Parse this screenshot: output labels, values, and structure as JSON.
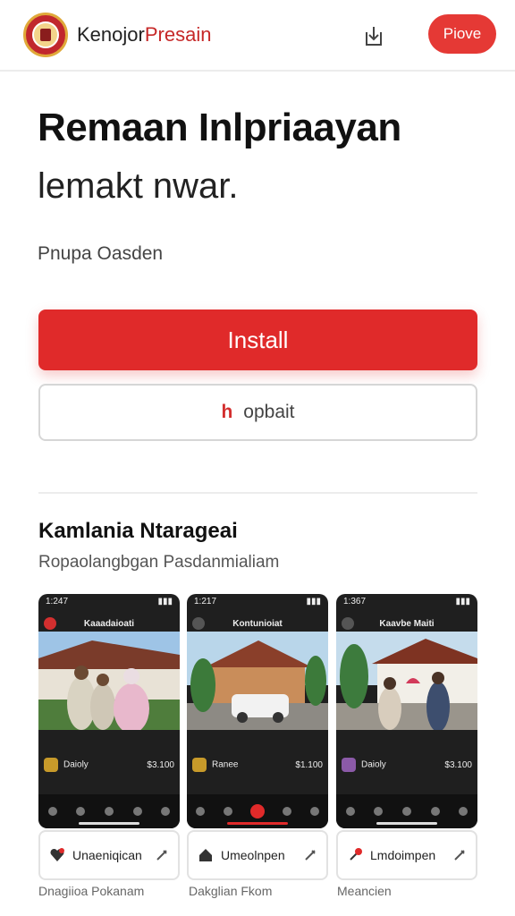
{
  "header": {
    "brand_main": "Kenojor",
    "brand_accent": "Presain",
    "pill_label": "Piove",
    "share_icon": "share-download-icon"
  },
  "hero": {
    "title": "Remaan Inlpriaayan",
    "subtitle": "lemakt nwar.",
    "developer": "Pnupa Oasden"
  },
  "actions": {
    "install_label": "Install",
    "secondary_mark": "h",
    "secondary_label": "opbait"
  },
  "section": {
    "title": "Kamlania Ntarageai",
    "subtitle": "Ropaolangbgan Pasdanmialiam"
  },
  "screenshots": [
    {
      "time": "1:247",
      "header": "Kaaadaioati",
      "price_title": "Daioly",
      "price_value": "$3.100"
    },
    {
      "time": "1:217",
      "header": "Kontunioiat",
      "price_title": "Ranee",
      "price_value": "$1.100"
    },
    {
      "time": "1:367",
      "header": "Kaavbe Maiti",
      "price_title": "Daioly",
      "price_value": "$3.100"
    }
  ],
  "chips": [
    {
      "label": "Unaeniqican"
    },
    {
      "label": "Umeolnpen"
    },
    {
      "label": "Lmdoimpen"
    }
  ],
  "captions": [
    "Dnagiioa Pokanam",
    "Dakglian Fkom",
    "Meancien"
  ],
  "colors": {
    "accent": "#e02a2a",
    "pill": "#e53935",
    "phone_bg": "#1f1f1f"
  }
}
